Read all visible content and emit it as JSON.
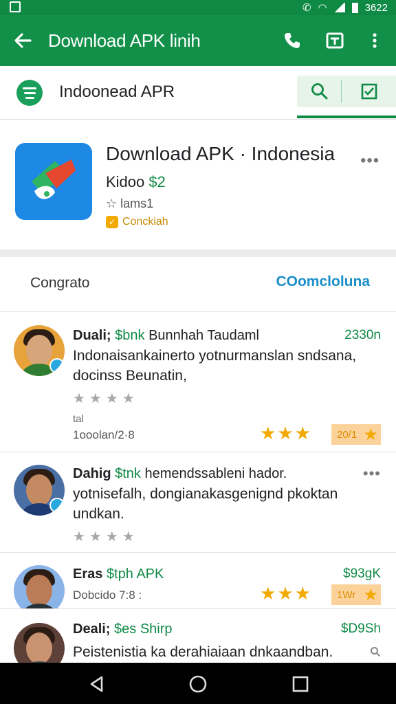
{
  "status_bar": {
    "time": "3622"
  },
  "app_bar": {
    "title": "Download APK linih",
    "back_icon": "arrow-back-icon",
    "icons": [
      "phone-icon",
      "translate-icon",
      "more-vert-icon"
    ]
  },
  "search": {
    "query": "Indoonead APR",
    "search_icon": "search-icon",
    "check_icon": "check-box-icon"
  },
  "app": {
    "name": "Download APK · Indonesia",
    "developer_prefix": "Kidoo",
    "developer_highlight": "$2",
    "rating_text": "lams1",
    "badge_label": "Conckiah",
    "more": "•••"
  },
  "reviews_header": {
    "label": "Congrato",
    "link": "COomcloluna"
  },
  "reviews": [
    {
      "name": "Duali;",
      "highlight": "$bnk",
      "title_rest": "Bunnhah Taudaml",
      "amount": "2330n",
      "text": "Indonaisankainerto yotnurmanslan sndsana, docinss Beunatin,",
      "grey_stars": "★★★★",
      "small": "tal",
      "date": "1ooolan/2·8",
      "gold_stars": "★★★",
      "score": "20/1"
    },
    {
      "name": "Dahig",
      "highlight": "$tnk",
      "title_rest": "hemendssableni hador.",
      "amount": "",
      "text": "yotnisefalh, dongianakasgenignd pkoktan undkan.",
      "grey_stars": "★★★★",
      "more": "•••"
    },
    {
      "name": "Eras",
      "highlight": "$tph",
      "title_rest": "APK",
      "amount": "$93gK",
      "date": "Dobcido 7:8 :",
      "gold_stars": "★★★",
      "score": "1Wr"
    },
    {
      "name": "Deali;",
      "highlight": "$es",
      "title_rest": "Shirp",
      "amount": "$D9Sh",
      "text": "Peistenistia ka derahiaiaan dnkaandban."
    }
  ],
  "nav": [
    "back-triangle-icon",
    "home-circle-icon",
    "recents-square-icon"
  ],
  "colors": {
    "brand_green": "#12904a",
    "accent_blue": "#1a8fc9",
    "star_gold": "#f2a900"
  }
}
